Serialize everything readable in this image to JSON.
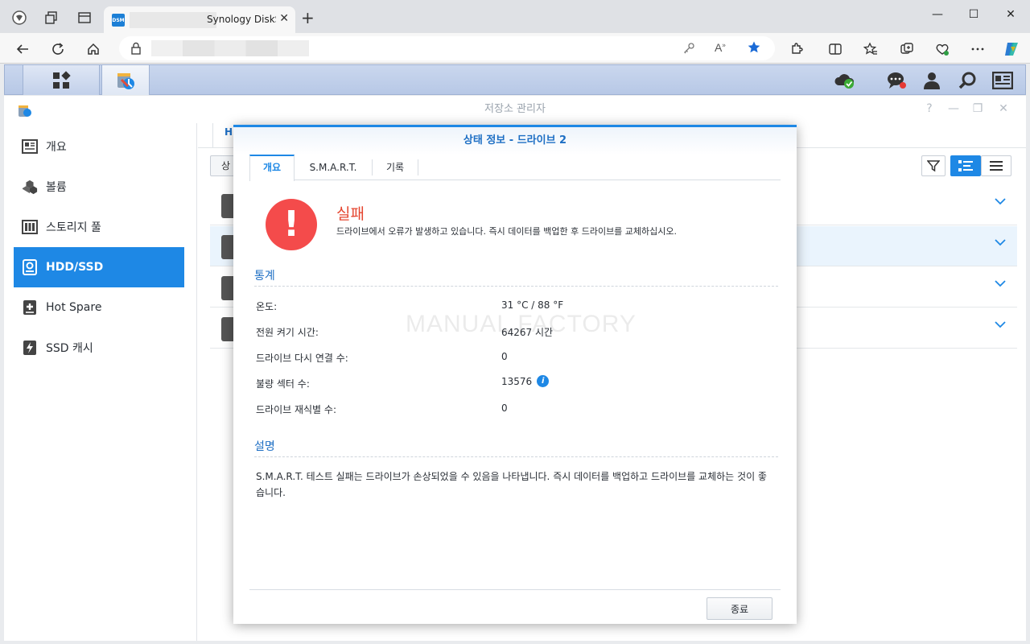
{
  "browser": {
    "tab_title": "Synology DiskS",
    "favicon_text": "DSM",
    "close_tab": "✕",
    "new_tab": "+",
    "window": {
      "minimize": "—",
      "maximize": "☐",
      "close": "✕"
    }
  },
  "app": {
    "title": "저장소 관리자",
    "sidebar": [
      {
        "label": "개요",
        "icon": "overview-icon"
      },
      {
        "label": "볼륨",
        "icon": "volume-icon"
      },
      {
        "label": "스토리지 풀",
        "icon": "storage-pool-icon"
      },
      {
        "label": "HDD/SSD",
        "icon": "hdd-icon",
        "active": true
      },
      {
        "label": "Hot Spare",
        "icon": "hot-spare-icon"
      },
      {
        "label": "SSD 캐시",
        "icon": "ssd-cache-icon"
      }
    ],
    "content": {
      "tab_partial": "HI",
      "button_partial": "상"
    }
  },
  "dialog": {
    "title": "상태 정보 - 드라이브 2",
    "tabs": [
      "개요",
      "S.M.A.R.T.",
      "기록"
    ],
    "status": {
      "title": "실패",
      "message": "드라이브에서 오류가 발생하고 있습니다. 즉시 데이터를 백업한 후 드라이브를 교체하십시오."
    },
    "stats_header": "통계",
    "stats": [
      {
        "label": "온도:",
        "value": "31 °C / 88 °F"
      },
      {
        "label": "전원 켜기 시간:",
        "value": "64267 시간"
      },
      {
        "label": "드라이브 다시 연결 수:",
        "value": "0"
      },
      {
        "label": "불량 섹터 수:",
        "value": "13576"
      },
      {
        "label": "드라이브 재식별 수:",
        "value": "0"
      }
    ],
    "info_icon_text": "i",
    "description_header": "설명",
    "description": "S.M.A.R.T. 테스트 실패는 드라이브가 손상되었을 수 있음을 나타냅니다. 즉시 데이터를 백업하고 드라이브를 교체하는 것이 좋습니다.",
    "watermark": "MANUAL FACTORY",
    "close_button": "종료"
  },
  "colors": {
    "accent": "#1e88e5",
    "fail": "#f44b4b",
    "fail_text": "#e5452f"
  }
}
